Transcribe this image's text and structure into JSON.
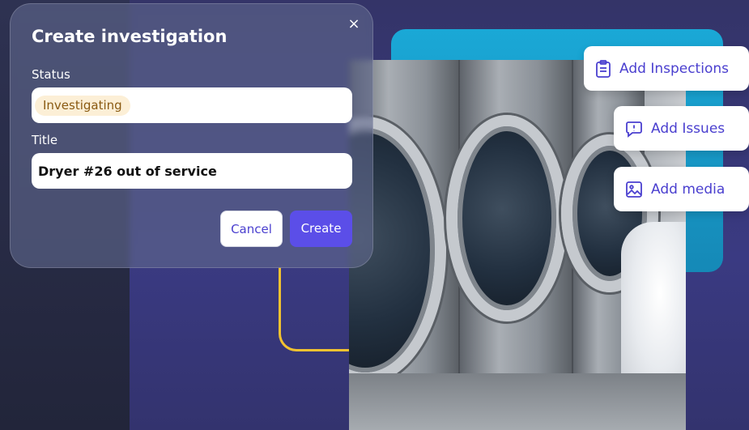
{
  "dialog": {
    "title": "Create investigation",
    "close_glyph": "×",
    "status_label": "Status",
    "status_value": "Investigating",
    "title_label": "Title",
    "title_value": "Dryer #26 out of service",
    "cancel_label": "Cancel",
    "create_label": "Create"
  },
  "actions": [
    {
      "label": "Add Inspections",
      "icon": "clipboard-list-icon"
    },
    {
      "label": "Add Issues",
      "icon": "alert-message-icon"
    },
    {
      "label": "Add media",
      "icon": "image-icon"
    }
  ],
  "colors": {
    "accent": "#5b4ee8",
    "accent_text": "#4a3fcf",
    "status_bg": "#fcefd6",
    "status_text": "#8a5a12",
    "teal": "#1aa8d6",
    "highlight_line": "#f2c230"
  }
}
